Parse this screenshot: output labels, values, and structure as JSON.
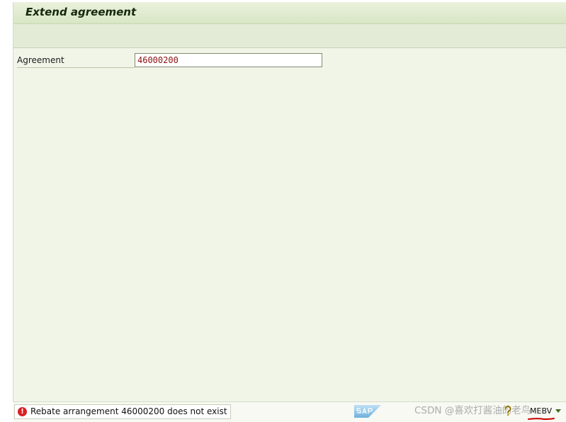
{
  "window": {
    "title": "Extend agreement"
  },
  "form": {
    "agreement_label": "Agreement",
    "agreement_value": "46000200"
  },
  "statusbar": {
    "message": "Rebate arrangement 46000200 does not exist",
    "message_type": "error",
    "watermark": "CSDN @喜欢打酱油的老鸟",
    "transaction_code": "MEBV"
  },
  "icons": {
    "status": "error-icon",
    "brand": "sap-logo",
    "help": "help-icon",
    "menu": "dropdown-arrow-icon"
  },
  "colors": {
    "background": "#f1f5e8",
    "title_bar": "#d9e6c5",
    "input_value": "#8a1010",
    "error": "#d92121",
    "annotation": "#cc0000"
  }
}
